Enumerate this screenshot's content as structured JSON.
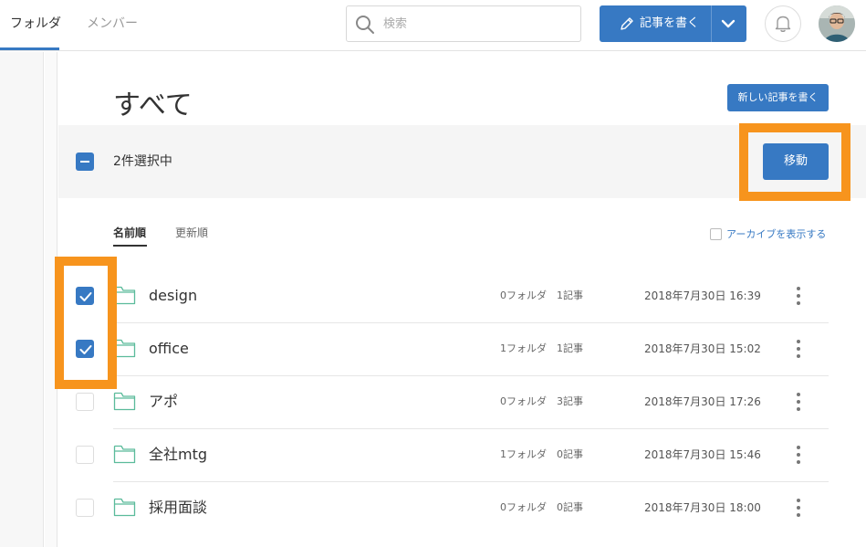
{
  "header": {
    "tabs": [
      {
        "label": "フォルダ",
        "active": true
      },
      {
        "label": "メンバー",
        "active": false
      }
    ],
    "search": {
      "placeholder": "検索",
      "value": ""
    },
    "write_button": {
      "label": "記事を書く"
    },
    "icons": {
      "search": "search-icon",
      "pen": "pencil-icon",
      "chevron": "chevron-down-icon",
      "bell": "bell-icon"
    }
  },
  "main": {
    "title": "すべて",
    "new_post_label": "新しい記事を書く",
    "selection": {
      "count_label": "2件選択中",
      "move_label": "移動"
    },
    "sort_tabs": [
      {
        "label": "名前順",
        "active": true
      },
      {
        "label": "更新順",
        "active": false
      }
    ],
    "archive_toggle": {
      "label": "アーカイブを表示する",
      "checked": false
    },
    "rows": [
      {
        "name": "design",
        "folders": "0フォルダ",
        "posts": "1記事",
        "updated": "2018年7月30日 16:39",
        "checked": true
      },
      {
        "name": "office",
        "folders": "1フォルダ",
        "posts": "1記事",
        "updated": "2018年7月30日 15:02",
        "checked": true
      },
      {
        "name": "アポ",
        "folders": "0フォルダ",
        "posts": "3記事",
        "updated": "2018年7月30日 17:26",
        "checked": false
      },
      {
        "name": "全社mtg",
        "folders": "1フォルダ",
        "posts": "0記事",
        "updated": "2018年7月30日 15:46",
        "checked": false
      },
      {
        "name": "採用面談",
        "folders": "0フォルダ",
        "posts": "0記事",
        "updated": "2018年7月30日 18:00",
        "checked": false
      }
    ]
  },
  "colors": {
    "accent": "#3779c3",
    "highlight": "#f7941d",
    "folder": "#5bbb9b"
  }
}
